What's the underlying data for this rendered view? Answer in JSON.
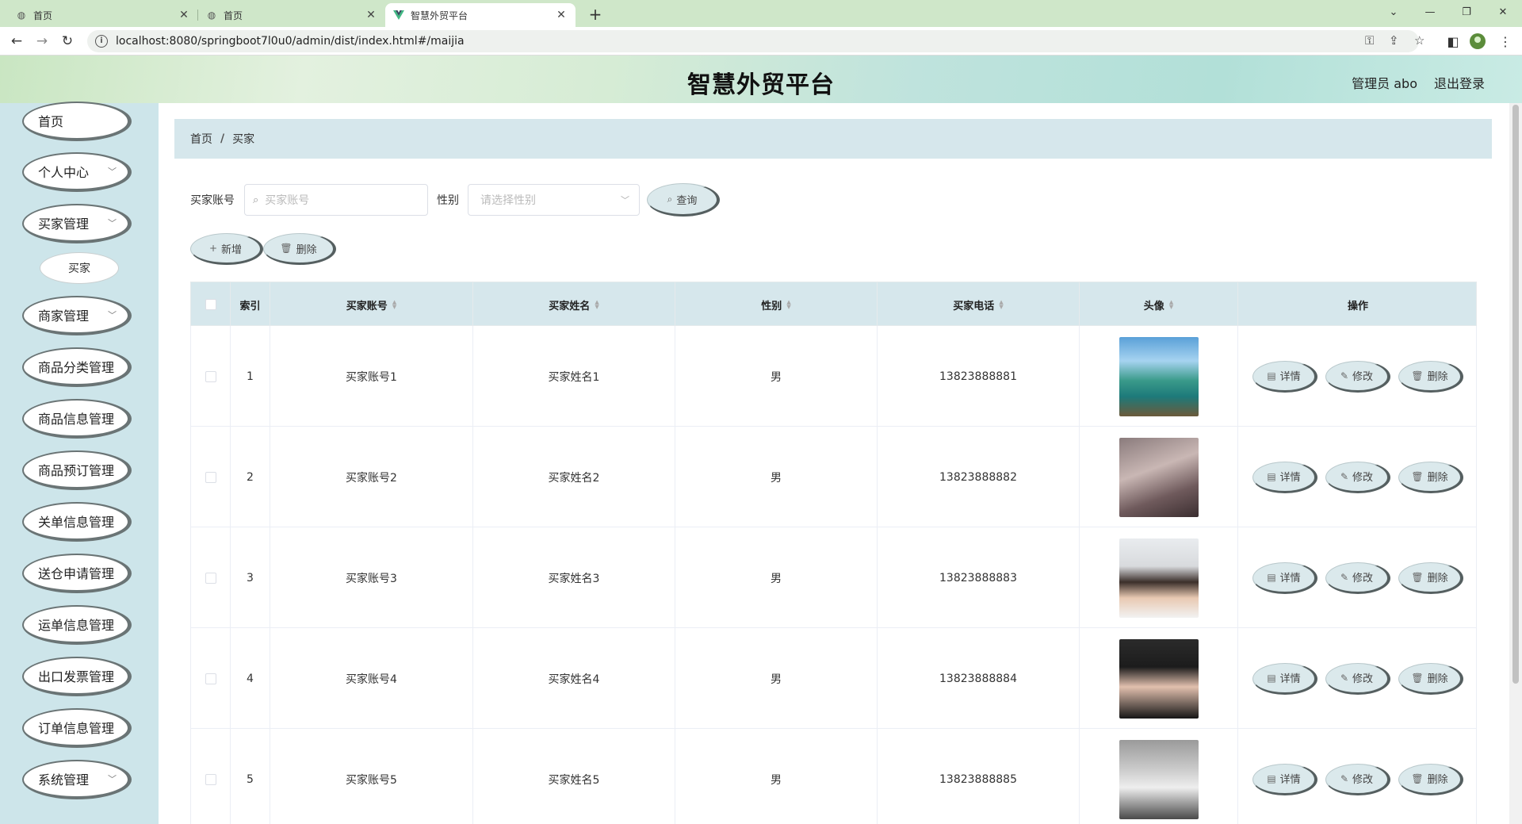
{
  "browser": {
    "tabs": [
      {
        "title": "首页",
        "icon": "globe-icon"
      },
      {
        "title": "首页",
        "icon": "globe-icon"
      },
      {
        "title": "智慧外贸平台",
        "icon": "vue-logo-icon"
      }
    ],
    "url": "localhost:8080/springboot7l0u0/admin/dist/index.html#/maijia"
  },
  "header": {
    "title": "智慧外贸平台",
    "user": "管理员 abo",
    "logout": "退出登录"
  },
  "sidebar": {
    "items": [
      {
        "label": "首页",
        "has_children": false
      },
      {
        "label": "个人中心",
        "has_children": true
      },
      {
        "label": "买家管理",
        "has_children": true
      },
      {
        "label": "商家管理",
        "has_children": true
      },
      {
        "label": "商品分类管理",
        "has_children": false
      },
      {
        "label": "商品信息管理",
        "has_children": false
      },
      {
        "label": "商品预订管理",
        "has_children": false
      },
      {
        "label": "关单信息管理",
        "has_children": false
      },
      {
        "label": "送仓申请管理",
        "has_children": false
      },
      {
        "label": "运单信息管理",
        "has_children": false
      },
      {
        "label": "出口发票管理",
        "has_children": false
      },
      {
        "label": "订单信息管理",
        "has_children": false
      },
      {
        "label": "系统管理",
        "has_children": true
      }
    ],
    "submenu_label": "买家"
  },
  "breadcrumb": {
    "home": "首页",
    "separator": "/",
    "current": "买家"
  },
  "filters": {
    "account_label": "买家账号",
    "account_placeholder": "买家账号",
    "gender_label": "性别",
    "gender_placeholder": "请选择性别",
    "query_button": "查询"
  },
  "actions": {
    "add": "新增",
    "delete": "删除"
  },
  "table": {
    "columns": [
      "索引",
      "买家账号",
      "买家姓名",
      "性别",
      "买家电话",
      "头像",
      "操作"
    ],
    "row_buttons": {
      "detail": "详情",
      "edit": "修改",
      "delete": "删除"
    },
    "rows": [
      {
        "index": "1",
        "account": "买家账号1",
        "name": "买家姓名1",
        "gender": "男",
        "phone": "13823888881",
        "avatar": "tropical-beach-photo"
      },
      {
        "index": "2",
        "account": "买家账号2",
        "name": "买家姓名2",
        "gender": "男",
        "phone": "13823888882",
        "avatar": "hooded-person-photo"
      },
      {
        "index": "3",
        "account": "买家账号3",
        "name": "买家姓名3",
        "gender": "男",
        "phone": "13823888883",
        "avatar": "man-glasses-photo"
      },
      {
        "index": "4",
        "account": "买家账号4",
        "name": "买家姓名4",
        "gender": "男",
        "phone": "13823888884",
        "avatar": "woman-portrait-photo"
      },
      {
        "index": "5",
        "account": "买家账号5",
        "name": "买家姓名5",
        "gender": "男",
        "phone": "13823888885",
        "avatar": "person-street-photo"
      }
    ]
  },
  "colors": {
    "tabbar": "#cfe7c9",
    "sidebar": "#cde5ea",
    "table_header": "#d6e7ec",
    "button_fill": "#dbe9ec"
  }
}
